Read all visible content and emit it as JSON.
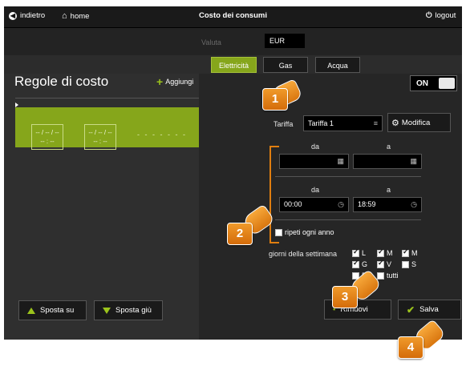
{
  "topbar": {
    "back_label": "indietro",
    "home_label": "home",
    "title": "Costo dei consumi",
    "logout_label": "logout"
  },
  "valuta": {
    "label": "Valuta",
    "value": "EUR"
  },
  "tabs": [
    {
      "label": "Elettricità",
      "active": true
    },
    {
      "label": "Gas",
      "active": false
    },
    {
      "label": "Acqua",
      "active": false
    }
  ],
  "left_panel": {
    "title": "Regole di costo",
    "add_label": "Aggiungi",
    "rule_card": {
      "date1": "-- / -- / --",
      "time1": "-- : --",
      "date2": "-- / -- / --",
      "time2": "-- : --",
      "dots": "- - - - - - -"
    },
    "move_up_label": "Sposta su",
    "move_down_label": "Sposta giù"
  },
  "toggle": {
    "label": "ON",
    "state": "on"
  },
  "tariffa": {
    "label": "Tariffa",
    "value": "Tariffa 1",
    "modify_label": "Modifica"
  },
  "date_range": {
    "from_label": "da",
    "to_label": "a",
    "from_date": "",
    "to_date": ""
  },
  "time_range": {
    "from_label": "da",
    "to_label": "a",
    "from_time": "00:00",
    "to_time": "18:59"
  },
  "repeat": {
    "label": "ripeti ogni anno",
    "checked": false
  },
  "weekdays": {
    "label": "giorni della settimana",
    "days": [
      {
        "label": "L",
        "checked": true
      },
      {
        "label": "M",
        "checked": true
      },
      {
        "label": "M",
        "checked": true
      },
      {
        "label": "G",
        "checked": true
      },
      {
        "label": "V",
        "checked": true
      },
      {
        "label": "S",
        "checked": false
      },
      {
        "label": "D",
        "checked": false
      }
    ],
    "all_label": "tutti"
  },
  "actions": {
    "remove_label": "Rimuovi",
    "save_label": "Salva"
  },
  "callouts": [
    "1",
    "2",
    "3",
    "4"
  ],
  "colors": {
    "accent_green": "#86a61b",
    "callout_orange": "#e07e10",
    "background": "#2c2c2c"
  }
}
